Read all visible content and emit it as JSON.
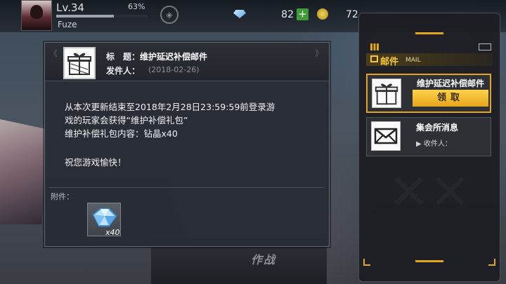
{
  "player": {
    "level": "Lv.34",
    "exp_percent": "63%",
    "exp_fraction": 0.63,
    "name": "Fuze"
  },
  "currency": {
    "gems": "82",
    "coins": "72"
  },
  "background": {
    "battle_label": "作战"
  },
  "mail_detail": {
    "subject_label": "标　题：",
    "subject": "维护延迟补偿邮件",
    "sender_label": "发件人：",
    "date": "(2018-02-26)",
    "body": "从本次更新结束至2018年2月28日23:59:59前登录游\n戏的玩家会获得“维护补偿礼包”\n维护补偿礼包内容：钻晶x40",
    "greeting": "祝您游戏愉快！",
    "attachments_label": "附件：",
    "attachment_qty": "x40"
  },
  "mail_list": {
    "title_cn": "邮件",
    "title_en": "MAIL",
    "items": [
      {
        "title": "维护延迟补偿邮件",
        "action": "领取"
      },
      {
        "title": "集会所消息",
        "recipient": "收件人："
      }
    ]
  },
  "icons": {
    "gift": "gift-icon",
    "envelope": "envelope-icon",
    "gem": "gem-icon",
    "coin": "coin-icon",
    "add": "plus-icon"
  },
  "colors": {
    "accent": "#e2a51c",
    "panel": "#2b2f36",
    "add_button": "#3f9b3a"
  }
}
